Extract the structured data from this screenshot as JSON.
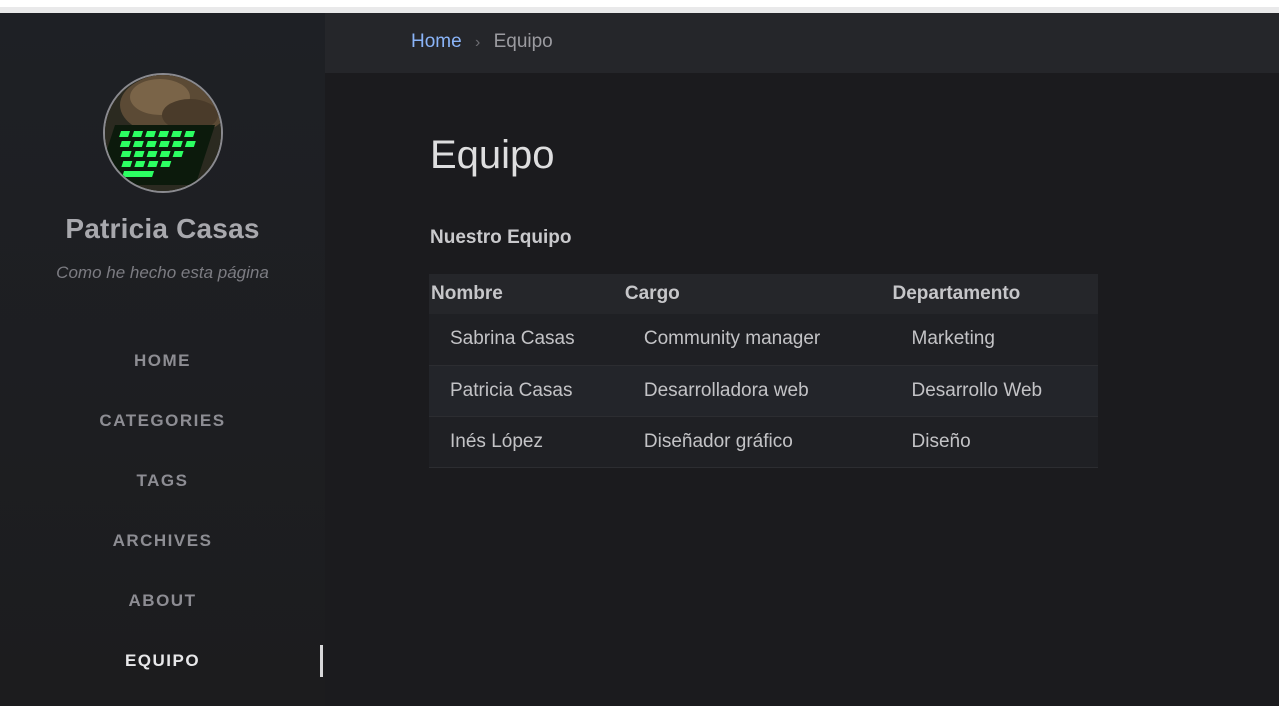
{
  "sidebar": {
    "title": "Patricia Casas",
    "subtitle": "Como he hecho esta página",
    "nav": [
      {
        "label": "HOME"
      },
      {
        "label": "CATEGORIES"
      },
      {
        "label": "TAGS"
      },
      {
        "label": "ARCHIVES"
      },
      {
        "label": "ABOUT"
      },
      {
        "label": "EQUIPO",
        "active": true
      }
    ]
  },
  "breadcrumb": {
    "home": "Home",
    "separator": "›",
    "current": "Equipo"
  },
  "page": {
    "title": "Equipo",
    "section_title": "Nuestro Equipo",
    "table": {
      "headers": [
        "Nombre",
        "Cargo",
        "Departamento"
      ],
      "rows": [
        [
          "Sabrina Casas",
          "Community manager",
          "Marketing"
        ],
        [
          "Patricia Casas",
          "Desarrolladora web",
          "Desarrollo Web"
        ],
        [
          "Inés López",
          "Diseñador gráfico",
          "Diseño"
        ]
      ]
    }
  },
  "colors": {
    "link": "#8ab4f8",
    "sidebar_bg": "#1e2025",
    "page_bg": "#1b1b1e"
  },
  "icons": {
    "avatar": "avatar-photo-cat-on-keyboard"
  }
}
